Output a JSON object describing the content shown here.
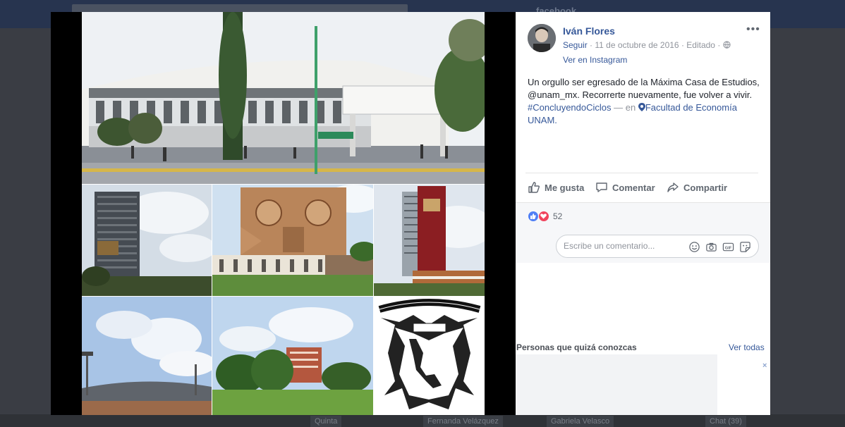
{
  "background": {
    "logo_text": "facebook",
    "chat_chips": [
      {
        "label": "Quinta"
      },
      {
        "label": "Fernanda Velázquez"
      },
      {
        "label": "Gabriela Velasco"
      },
      {
        "label": "Chat (39)"
      }
    ]
  },
  "post": {
    "author": "Iván Flores",
    "follow": "Seguir",
    "dot": "·",
    "date": "11 de octubre de 2016",
    "edited": "Editado",
    "instagram_link": "Ver en Instagram",
    "more_label": "•••",
    "text_plain": "Un orgullo ser egresado de la Máxima Casa de Estudios, @unam_mx. Recorrerte nuevamente, fue volver a vivir. ",
    "hashtag": "#ConcluyendoCiclos",
    "separator": "— en",
    "place": "Facultad de Economía UNAM."
  },
  "actions": {
    "like": "Me gusta",
    "comment": "Comentar",
    "share": "Compartir"
  },
  "reactions": {
    "count": "52"
  },
  "comment": {
    "placeholder": "Escribe un comentario..."
  },
  "people_you_may_know": {
    "title": "Personas que quizá conozcas",
    "see_all": "Ver todas",
    "close": "×"
  },
  "colors": {
    "link": "#365899",
    "like_blue": "#4f7ff5",
    "love_red": "#f0445d",
    "unam_red": "#8b1e22"
  }
}
